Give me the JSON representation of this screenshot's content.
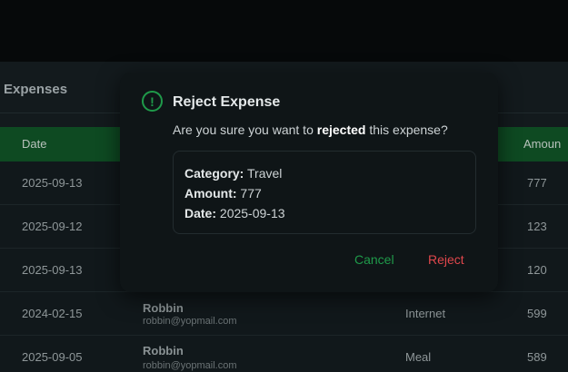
{
  "page": {
    "title": "Expenses"
  },
  "table": {
    "columns": {
      "date": "Date",
      "amount": "Amoun"
    },
    "rows": [
      {
        "date": "2025-09-13",
        "amount": "777"
      },
      {
        "date": "2025-09-12",
        "amount": "123"
      },
      {
        "date": "2025-09-13",
        "amount": "120"
      },
      {
        "date": "2024-02-15",
        "name": "Robbin",
        "email": "robbin@yopmail.com",
        "category": "Internet",
        "amount": "599"
      },
      {
        "date": "2025-09-05",
        "name": "Robbin",
        "email": "robbin@yopmail.com",
        "category": "Meal",
        "amount": "589"
      }
    ]
  },
  "modal": {
    "icon": "exclamation-circle-icon",
    "title": "Reject Expense",
    "message_prefix": "Are you sure you want to ",
    "message_bold": "rejected",
    "message_suffix": " this expense?",
    "details": {
      "category_label": "Category:",
      "category_value": " Travel",
      "amount_label": "Amount:",
      "amount_value": " 777",
      "date_label": "Date:",
      "date_value": " 2025-09-13"
    },
    "cancel_label": "Cancel",
    "reject_label": "Reject"
  },
  "colors": {
    "accent": "#1f9a4a",
    "danger": "#e0474c",
    "header": "#0e4a22"
  }
}
